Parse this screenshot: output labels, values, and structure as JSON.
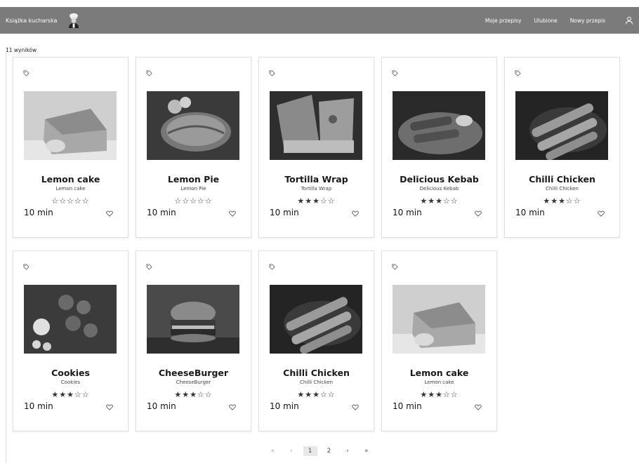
{
  "header": {
    "title": "Książka kucharska",
    "logo_icon": "chef-icon",
    "nav": [
      "Moje przepisy",
      "Ulubione",
      "Nowy przepis"
    ],
    "user_icon": "user-icon",
    "colors": {
      "bar": "#7b7b7b",
      "text": "#ffffff"
    }
  },
  "results_label": "11 wyników",
  "cards": [
    {
      "title": "Lemon cake",
      "subtitle": "Lemon cake",
      "stars": "☆☆☆☆☆",
      "rating": 0,
      "time": "10 min",
      "tag_icon": "tag-icon",
      "fav_icon": "heart-icon",
      "photo": "lemon-cake"
    },
    {
      "title": "Lemon Pie",
      "subtitle": "Lemon Pie",
      "stars": "☆☆☆☆☆",
      "rating": 0,
      "time": "10 min",
      "tag_icon": "tag-icon",
      "fav_icon": "heart-icon",
      "photo": "lemon-pie"
    },
    {
      "title": "Tortilla Wrap",
      "subtitle": "Tortilla Wrap",
      "stars": "★★★☆☆",
      "rating": 3,
      "time": "10 min",
      "tag_icon": "tag-icon",
      "fav_icon": "heart-icon",
      "photo": "tortilla-wrap"
    },
    {
      "title": "Delicious Kebab",
      "subtitle": "Delicious Kebab",
      "stars": "★★★☆☆",
      "rating": 3,
      "time": "10 min",
      "tag_icon": "tag-icon",
      "fav_icon": "heart-icon",
      "photo": "kebab"
    },
    {
      "title": "Chilli Chicken",
      "subtitle": "Chilli Chicken",
      "stars": "★★★☆☆",
      "rating": 3,
      "time": "10 min",
      "tag_icon": "tag-icon",
      "fav_icon": "heart-icon",
      "photo": "chicken-skewers"
    },
    {
      "title": "Cookies",
      "subtitle": "Cookies",
      "stars": "★★★☆☆",
      "rating": 3,
      "time": "10 min",
      "tag_icon": "tag-icon",
      "fav_icon": "heart-icon",
      "photo": "cookies"
    },
    {
      "title": "CheeseBurger",
      "subtitle": "CheeseBurger",
      "stars": "★★★☆☆",
      "rating": 3,
      "time": "10 min",
      "tag_icon": "tag-icon",
      "fav_icon": "heart-icon",
      "photo": "burger"
    },
    {
      "title": "Chilli Chicken",
      "subtitle": "Chilli Chicken",
      "stars": "★★★☆☆",
      "rating": 3,
      "time": "10 min",
      "tag_icon": "tag-icon",
      "fav_icon": "heart-icon",
      "photo": "chicken-skewers"
    },
    {
      "title": "Lemon cake",
      "subtitle": "Lemon cake",
      "stars": "★★★☆☆",
      "rating": 3,
      "time": "10 min",
      "tag_icon": "tag-icon",
      "fav_icon": "heart-icon",
      "photo": "lemon-cake"
    }
  ],
  "pagination": {
    "first": "«",
    "prev": "‹",
    "pages": [
      "1",
      "2"
    ],
    "current": "1",
    "next": "›",
    "last": "»"
  }
}
